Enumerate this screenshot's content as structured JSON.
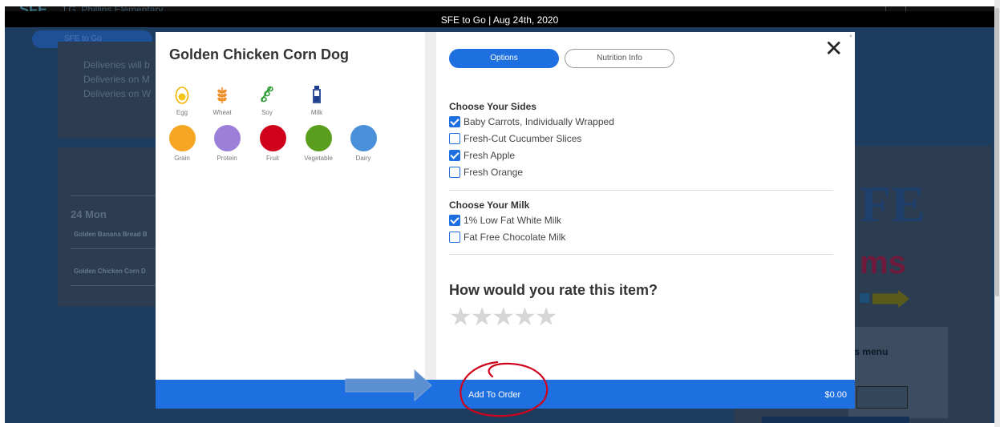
{
  "window": {
    "title": "SFE to Go | Aug 24th, 2020"
  },
  "background": {
    "logo": "SFE",
    "school": "J.G. Phillips Elementary",
    "pill": "SFE to Go",
    "deliveries": [
      "Deliveries will b",
      "Deliveries on M",
      "Deliveries on W"
    ],
    "date": "24  Mon",
    "rows": [
      "Golden Banana Bread B",
      "Golden Chicken Corn D"
    ],
    "brand_big": "FE",
    "brand_ms": "ms",
    "menu_text": "is menu"
  },
  "item": {
    "title": "Golden Chicken Corn Dog"
  },
  "allergens": [
    {
      "label": "Egg",
      "icon": "egg-icon",
      "color": "#f5c518"
    },
    {
      "label": "Wheat",
      "icon": "wheat-icon",
      "color": "#f0902a"
    },
    {
      "label": "Soy",
      "icon": "soy-icon",
      "color": "#2e9d35"
    },
    {
      "label": "Milk",
      "icon": "milk-icon",
      "color": "#1e3f8e"
    }
  ],
  "food_groups": [
    {
      "label": "Grain",
      "color": "#f5a623"
    },
    {
      "label": "Protein",
      "color": "#9b7fd9"
    },
    {
      "label": "Fruit",
      "color": "#d0021b"
    },
    {
      "label": "Vegetable",
      "color": "#5a9e1e"
    },
    {
      "label": "Dairy",
      "color": "#4a90d9"
    }
  ],
  "tabs": {
    "options": "Options",
    "nutrition": "Nutrition Info"
  },
  "sides": {
    "title": "Choose Your Sides",
    "options": [
      {
        "label": "Baby Carrots, Individually Wrapped",
        "checked": true
      },
      {
        "label": "Fresh-Cut Cucumber Slices",
        "checked": false
      },
      {
        "label": "Fresh Apple",
        "checked": true
      },
      {
        "label": "Fresh Orange",
        "checked": false
      }
    ]
  },
  "milk": {
    "title": "Choose Your Milk",
    "options": [
      {
        "label": "1% Low Fat White Milk",
        "checked": true
      },
      {
        "label": "Fat Free Chocolate Milk",
        "checked": false
      }
    ]
  },
  "rating": {
    "question": "How would you rate this item?",
    "stars": 0,
    "max": 5
  },
  "footer": {
    "add_label": "Add To Order",
    "price": "$0.00"
  },
  "colors": {
    "accent": "#1e6fe0",
    "annotation_circle": "#d0021b",
    "annotation_arrow": "#5b8fd1"
  }
}
